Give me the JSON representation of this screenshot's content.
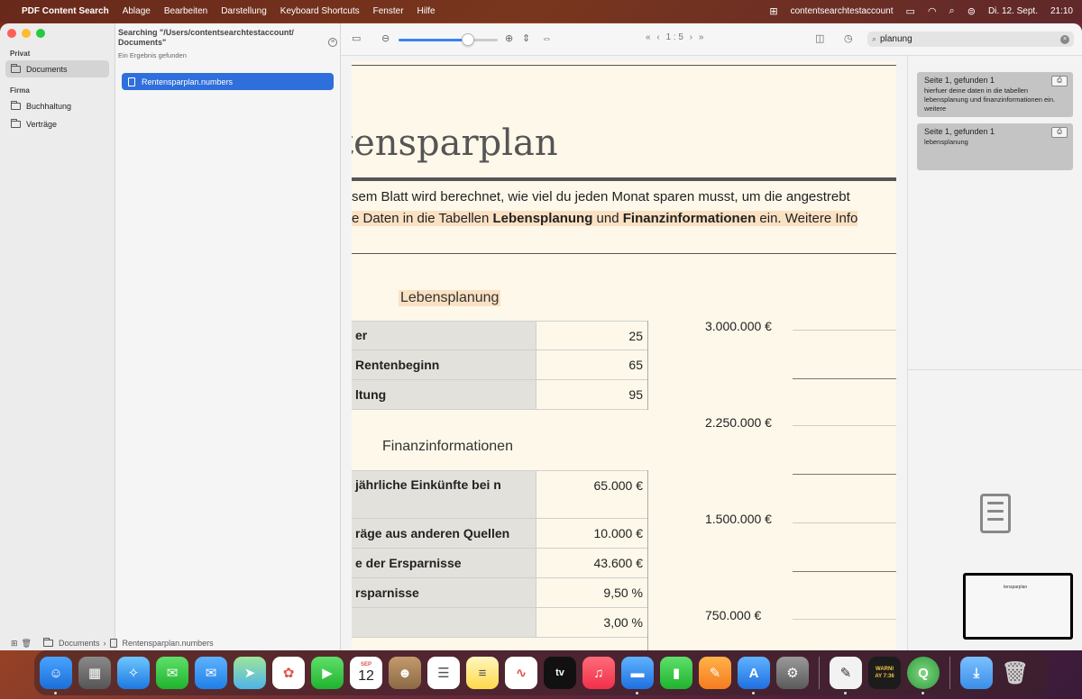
{
  "menubar": {
    "app_name": "PDF Content Search",
    "menus": [
      "Ablage",
      "Bearbeiten",
      "Darstellung",
      "Keyboard Shortcuts",
      "Fenster",
      "Hilfe"
    ],
    "account": "contentsearchtestaccount",
    "date": "Di. 12. Sept.",
    "time": "21:10"
  },
  "sidebar": {
    "section_private": "Privat",
    "private_items": [
      {
        "label": "Documents",
        "selected": true
      }
    ],
    "section_company": "Firma",
    "company_items": [
      {
        "label": "Buchhaltung"
      },
      {
        "label": "Verträge"
      }
    ]
  },
  "results": {
    "searching": "Searching \"/Users/contentsearchtestaccount/ Documents\"",
    "count_text": "Ein Ergebnis gefunden",
    "items": [
      {
        "label": "Rentensparplan.numbers",
        "selected": true
      }
    ]
  },
  "toolbar": {
    "page_indicator": "1 : 5",
    "zoom_percent": 70,
    "search_value": "planung"
  },
  "pdf": {
    "title": "tensparplan",
    "intro_line1": "sem Blatt wird berechnet, wie viel du jeden Monat sparen musst, um die angestrebt",
    "intro_line2_a": "e Daten in die Tabellen ",
    "intro_line2_b": "Lebensplanung",
    "intro_line2_c": " und ",
    "intro_line2_d": "Finanzinformationen",
    "intro_line2_e": " ein. Weitere Info",
    "section1": "Lebensplanung",
    "table1": [
      {
        "label": "er",
        "value": "25"
      },
      {
        "label": " Rentenbeginn",
        "value": "65"
      },
      {
        "label": "ltung",
        "value": "95"
      }
    ],
    "section2": "Finanzinformationen",
    "table2": [
      {
        "label": "jährliche Einkünfte bei n",
        "value": "65.000 €"
      },
      {
        "label": "räge aus anderen Quellen",
        "value": "10.000 €"
      },
      {
        "label": "e der Ersparnisse",
        "value": "43.600 €"
      },
      {
        "label": "rsparnisse",
        "value": "9,50 %"
      },
      {
        "label": "",
        "value": "3,00 %"
      }
    ],
    "axis_labels": [
      "3.000.000 €",
      "2.250.000 €",
      "1.500.000 €",
      "750.000 €"
    ]
  },
  "hits": {
    "items": [
      {
        "title": "Seite 1, gefunden 1",
        "text": "hierfuer deine daten in die tabellen lebensplanung und finanzinformationen ein. weitere"
      },
      {
        "title": "Seite 1, gefunden 1",
        "text": "lebensplanung"
      }
    ]
  },
  "path_bar": {
    "folder": "Documents",
    "file": "Rentensparplan.numbers"
  },
  "thumbnail": {
    "title": "tensparplan"
  },
  "dock": {
    "calendar_month": "SEP",
    "calendar_day": "12",
    "tv_label": "tv",
    "console_text": "WARNI\nAY 7:36"
  }
}
